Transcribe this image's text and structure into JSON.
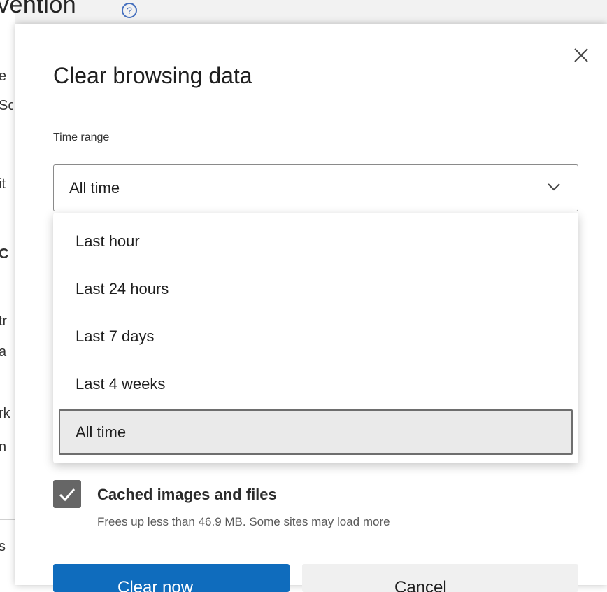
{
  "background": {
    "title_fragment": "vention",
    "help_icon": "help-circle-icon",
    "fragments": [
      "e",
      "Sc",
      "it",
      "C",
      "tr",
      "a",
      "rk",
      "n",
      "s"
    ]
  },
  "dialog": {
    "title": "Clear browsing data",
    "close_icon": "close-icon",
    "time_range": {
      "label": "Time range",
      "selected": "All time",
      "options": [
        "Last hour",
        "Last 24 hours",
        "Last 7 days",
        "Last 4 weeks",
        "All time"
      ]
    },
    "cached": {
      "checked": true,
      "label": "Cached images and files",
      "description": "Frees up less than 46.9 MB. Some sites may load more"
    },
    "buttons": {
      "primary": "Clear now",
      "secondary": "Cancel"
    }
  },
  "colors": {
    "accent": "#0f6cbd",
    "checkbox": "#666666"
  }
}
